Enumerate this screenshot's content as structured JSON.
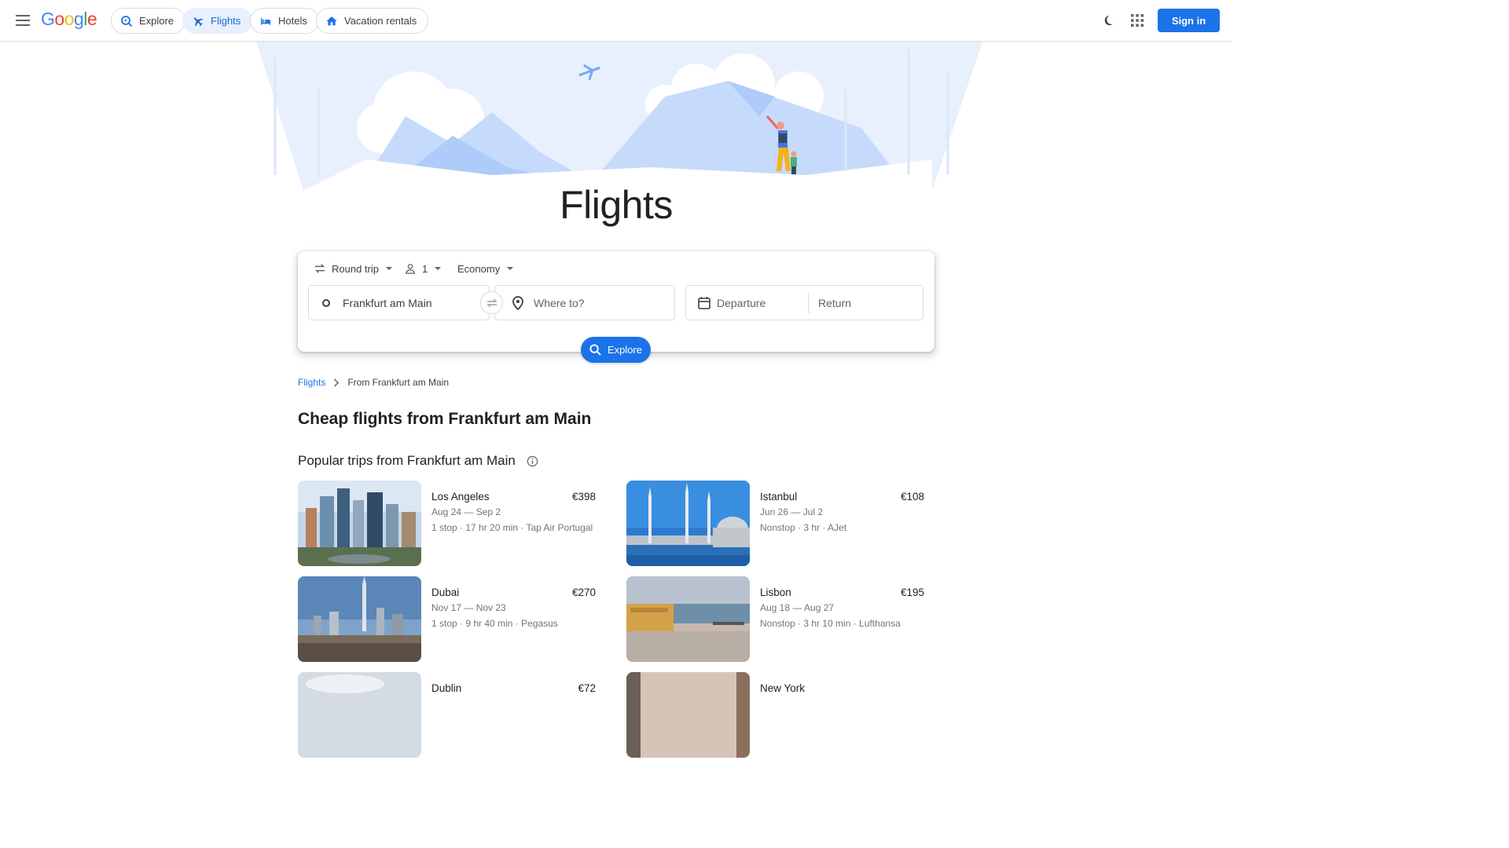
{
  "header": {
    "logo_text": "Google",
    "menu_icon": "hamburger-menu-icon",
    "nav": [
      {
        "label": "Explore",
        "icon": "explore-icon",
        "active": false
      },
      {
        "label": "Flights",
        "icon": "airplane-icon",
        "active": true
      },
      {
        "label": "Hotels",
        "icon": "bed-icon",
        "active": false
      },
      {
        "label": "Vacation rentals",
        "icon": "house-icon",
        "active": false
      }
    ],
    "theme_icon": "moon-icon",
    "apps_icon": "apps-grid-icon",
    "sign_in_label": "Sign in"
  },
  "hero": {
    "title": "Flights"
  },
  "search": {
    "trip_type": "Round trip",
    "passengers": "1",
    "cabin_class": "Economy",
    "origin": "Frankfurt am Main",
    "destination_placeholder": "Where to?",
    "departure_placeholder": "Departure",
    "return_placeholder": "Return",
    "explore_label": "Explore"
  },
  "breadcrumb": {
    "root": "Flights",
    "current": "From Frankfurt am Main"
  },
  "main": {
    "heading": "Cheap flights from Frankfurt am Main",
    "popular_heading": "Popular trips from Frankfurt am Main",
    "trips": [
      {
        "city": "Los Angeles",
        "price": "€398",
        "dates": "Aug 24 — Sep 2",
        "details": "1 stop · 17 hr 20 min · Tap Air Portugal"
      },
      {
        "city": "Istanbul",
        "price": "€108",
        "dates": "Jun 26 — Jul 2",
        "details": "Nonstop · 3 hr · AJet"
      },
      {
        "city": "Dubai",
        "price": "€270",
        "dates": "Nov 17 — Nov 23",
        "details": "1 stop · 9 hr 40 min · Pegasus"
      },
      {
        "city": "Lisbon",
        "price": "€195",
        "dates": "Aug 18 — Aug 27",
        "details": "Nonstop · 3 hr 10 min · Lufthansa"
      },
      {
        "city": "Dublin",
        "price": "€72",
        "dates": "",
        "details": ""
      },
      {
        "city": "New York",
        "price": "",
        "dates": "",
        "details": ""
      }
    ]
  },
  "colors": {
    "accent": "#1a73e8",
    "active_chip_bg": "#e8f0fe",
    "border": "#dadce0",
    "secondary_text": "#70757a"
  }
}
